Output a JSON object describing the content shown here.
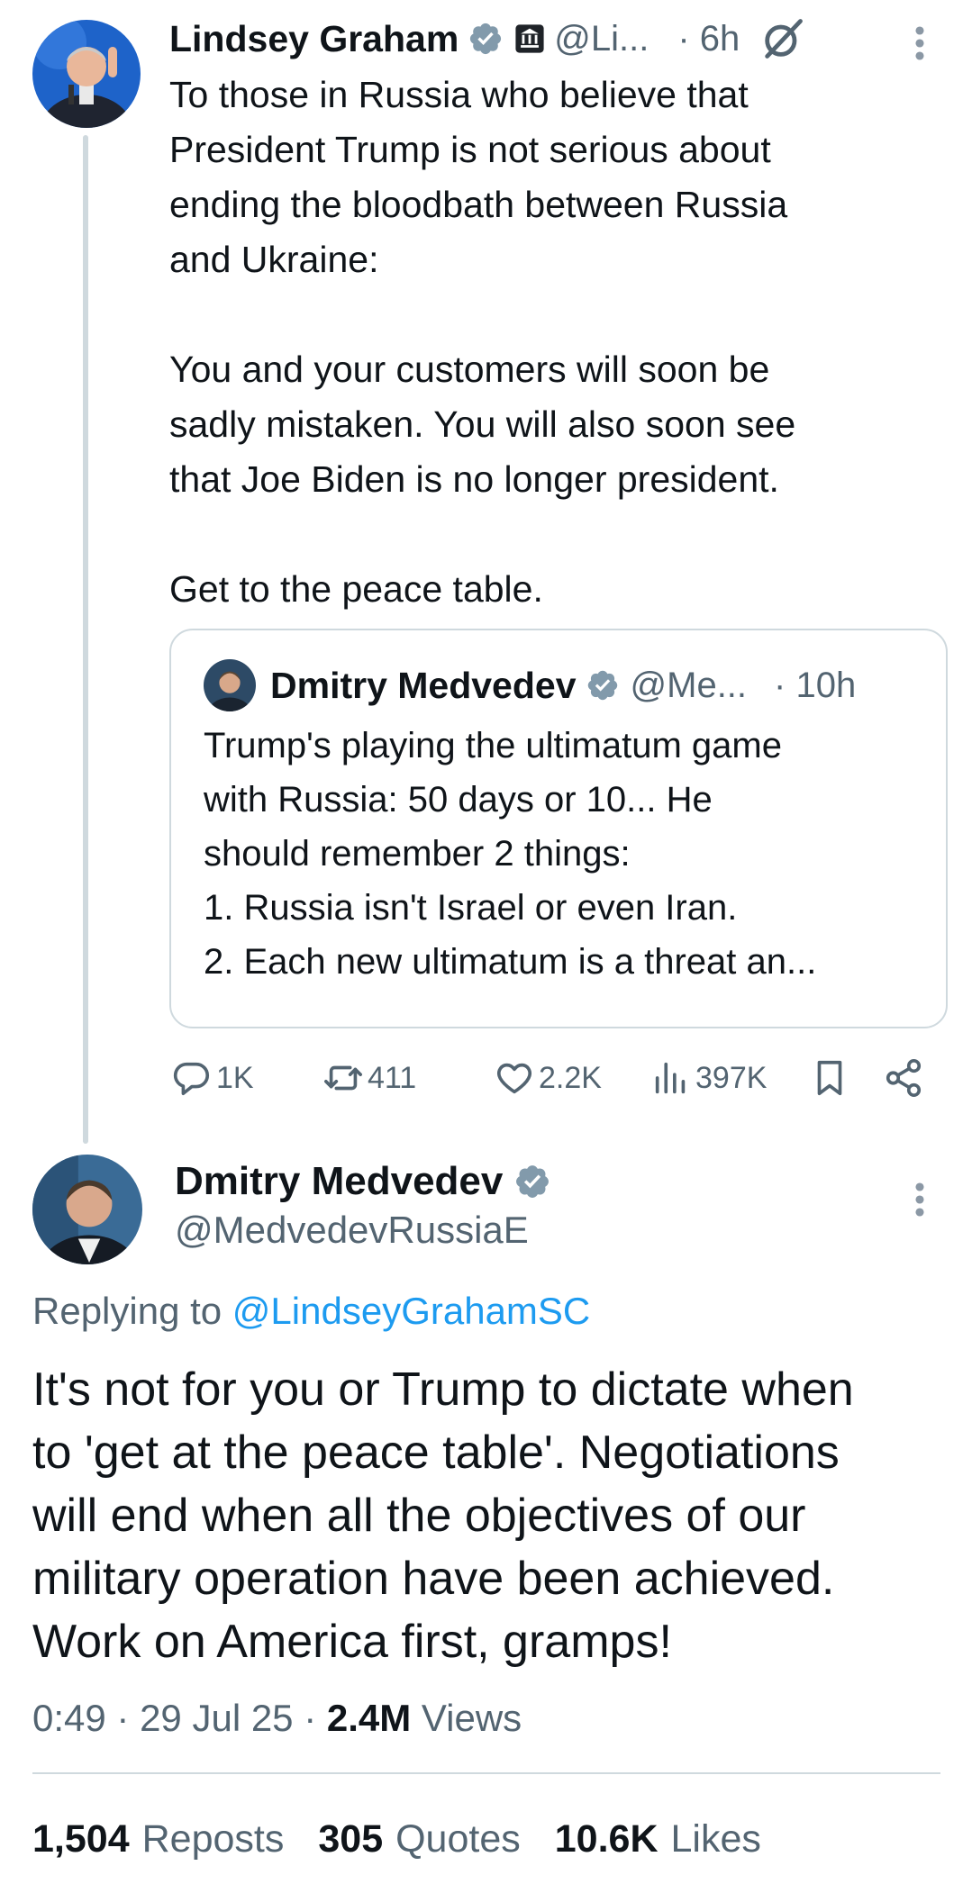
{
  "parent_tweet": {
    "author_name": "Lindsey Graham",
    "handle": "@Li...",
    "time": "· 6h",
    "paragraphs": [
      [
        "To those in Russia who believe that",
        "President Trump is not serious about",
        "ending the bloodbath between Russia",
        "and Ukraine:"
      ],
      [
        "You and your customers will soon be",
        "sadly mistaken. You will also soon see",
        "that Joe Biden is no longer president."
      ],
      [
        "Get to the peace table."
      ]
    ],
    "quoted_tweet": {
      "author_name": "Dmitry Medvedev",
      "handle": "@Me...",
      "time": "· 10h",
      "lines": [
        "Trump's playing the ultimatum game",
        "with Russia: 50 days or 10... He",
        "should remember 2 things:",
        "1. Russia isn't Israel or even Iran.",
        "2. Each new ultimatum is a threat an..."
      ]
    },
    "actions": {
      "replies": "1K",
      "reposts": "411",
      "likes": "2.2K",
      "views": "397K"
    }
  },
  "main_tweet": {
    "author_name": "Dmitry Medvedev",
    "handle": "@MedvedevRussiaE",
    "replying_prefix": "Replying to",
    "replying_mention": "@LindseyGrahamSC",
    "lines": [
      "It's not for you or Trump to dictate when",
      "to 'get at the peace table'. Negotiations",
      "will end when all the objectives of our",
      "military operation have been achieved.",
      "Work on America first, gramps!"
    ],
    "timestamp": "0:49 · 29 Jul 25 ·",
    "views_count": "2.4M",
    "views_label": "Views",
    "stats": [
      {
        "num": "1,504",
        "label": "Reposts"
      },
      {
        "num": "305",
        "label": "Quotes"
      },
      {
        "num": "10.6K",
        "label": "Likes"
      }
    ]
  },
  "colors": {
    "text_primary": "#0f1419",
    "text_secondary": "#536471",
    "link": "#1d9bf0",
    "verified_badge": "#829aab",
    "border": "#cfd9de"
  },
  "icons": [
    "verified-badge-icon",
    "government-badge-icon",
    "grok-icon",
    "more-options-icon",
    "reply-icon",
    "repost-icon",
    "like-icon",
    "views-icon",
    "bookmark-icon",
    "share-icon"
  ]
}
